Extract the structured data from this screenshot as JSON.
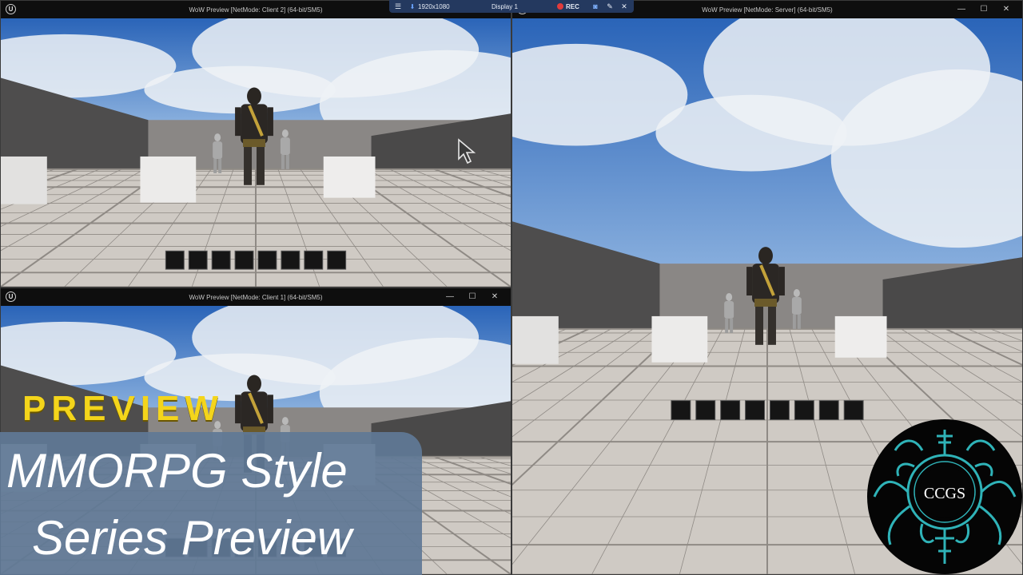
{
  "recorder": {
    "menu_icon": "hamburger-icon",
    "pin_icon": "pin-icon",
    "resolution": "1920x1080",
    "display": "Display 1",
    "rec_label": "REC",
    "rec_color": "#e23b3b",
    "camera_icon": "camera-icon",
    "pen_icon": "pen-icon",
    "close_icon": "close-icon"
  },
  "windows": {
    "client2": {
      "logo": "U",
      "title": "WoW Preview [NetMode: Client 2]  (64-bit/SM5)",
      "min": "—",
      "max": "☐",
      "close": "✕"
    },
    "client1": {
      "logo": "U",
      "title": "WoW Preview [NetMode: Client 1]  (64-bit/SM5)",
      "min": "—",
      "max": "☐",
      "close": "✕"
    },
    "server": {
      "logo": "U",
      "title": "WoW Preview [NetMode: Server]  (64-bit/SM5)",
      "min": "—",
      "max": "☐",
      "close": "✕"
    }
  },
  "hotbar": {
    "slot_count": 8
  },
  "overlay": {
    "preview_label": "PREVIEW",
    "preview_color": "#f4d51b",
    "series_line1": "MMORPG Style",
    "series_line2": "Series Preview",
    "panel_color": "#6078a0"
  },
  "logo": {
    "text": "CCGS",
    "accent": "#2fb3b8"
  }
}
